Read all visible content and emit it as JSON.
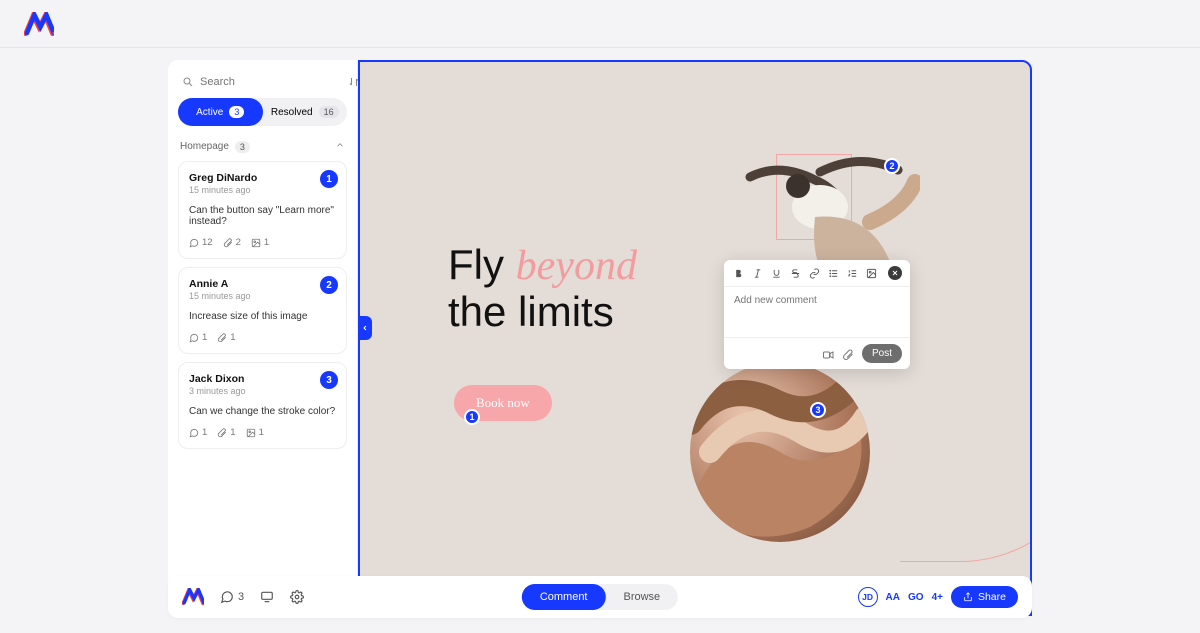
{
  "topbar": {
    "logo_alt": "Brand"
  },
  "search": {
    "placeholder": "Search"
  },
  "tabs": {
    "active": {
      "label": "Active",
      "count": "3"
    },
    "resolved": {
      "label": "Resolved",
      "count": "16"
    }
  },
  "section": {
    "name": "Homepage",
    "count": "3"
  },
  "comments": [
    {
      "author": "Greg DiNardo",
      "time": "15 minutes ago",
      "msg": "Can the button say \"Learn more\" instead?",
      "reply_count": "12",
      "attach_count": "2",
      "image_count": "1",
      "num": "1"
    },
    {
      "author": "Annie A",
      "time": "15 minutes ago",
      "msg": "Increase size of this image",
      "reply_count": "1",
      "attach_count": "1",
      "image_count": "",
      "num": "2"
    },
    {
      "author": "Jack Dixon",
      "time": "3 minutes ago",
      "msg": "Can we change the stroke color?",
      "reply_count": "1",
      "attach_count": "1",
      "image_count": "1",
      "num": "3"
    }
  ],
  "hero": {
    "l1a": "Fly ",
    "l1b": "beyond",
    "l2": "the limits",
    "cta": "Book now"
  },
  "markers": {
    "m1": "1",
    "m2": "2",
    "m3": "3"
  },
  "popover": {
    "placeholder": "Add new comment",
    "post": "Post"
  },
  "bottombar": {
    "comment_count": "3",
    "mode_comment": "Comment",
    "mode_browse": "Browse",
    "user1": "JD",
    "user2": "AA",
    "user3": "GO",
    "overflow": "4+",
    "share": "Share"
  }
}
